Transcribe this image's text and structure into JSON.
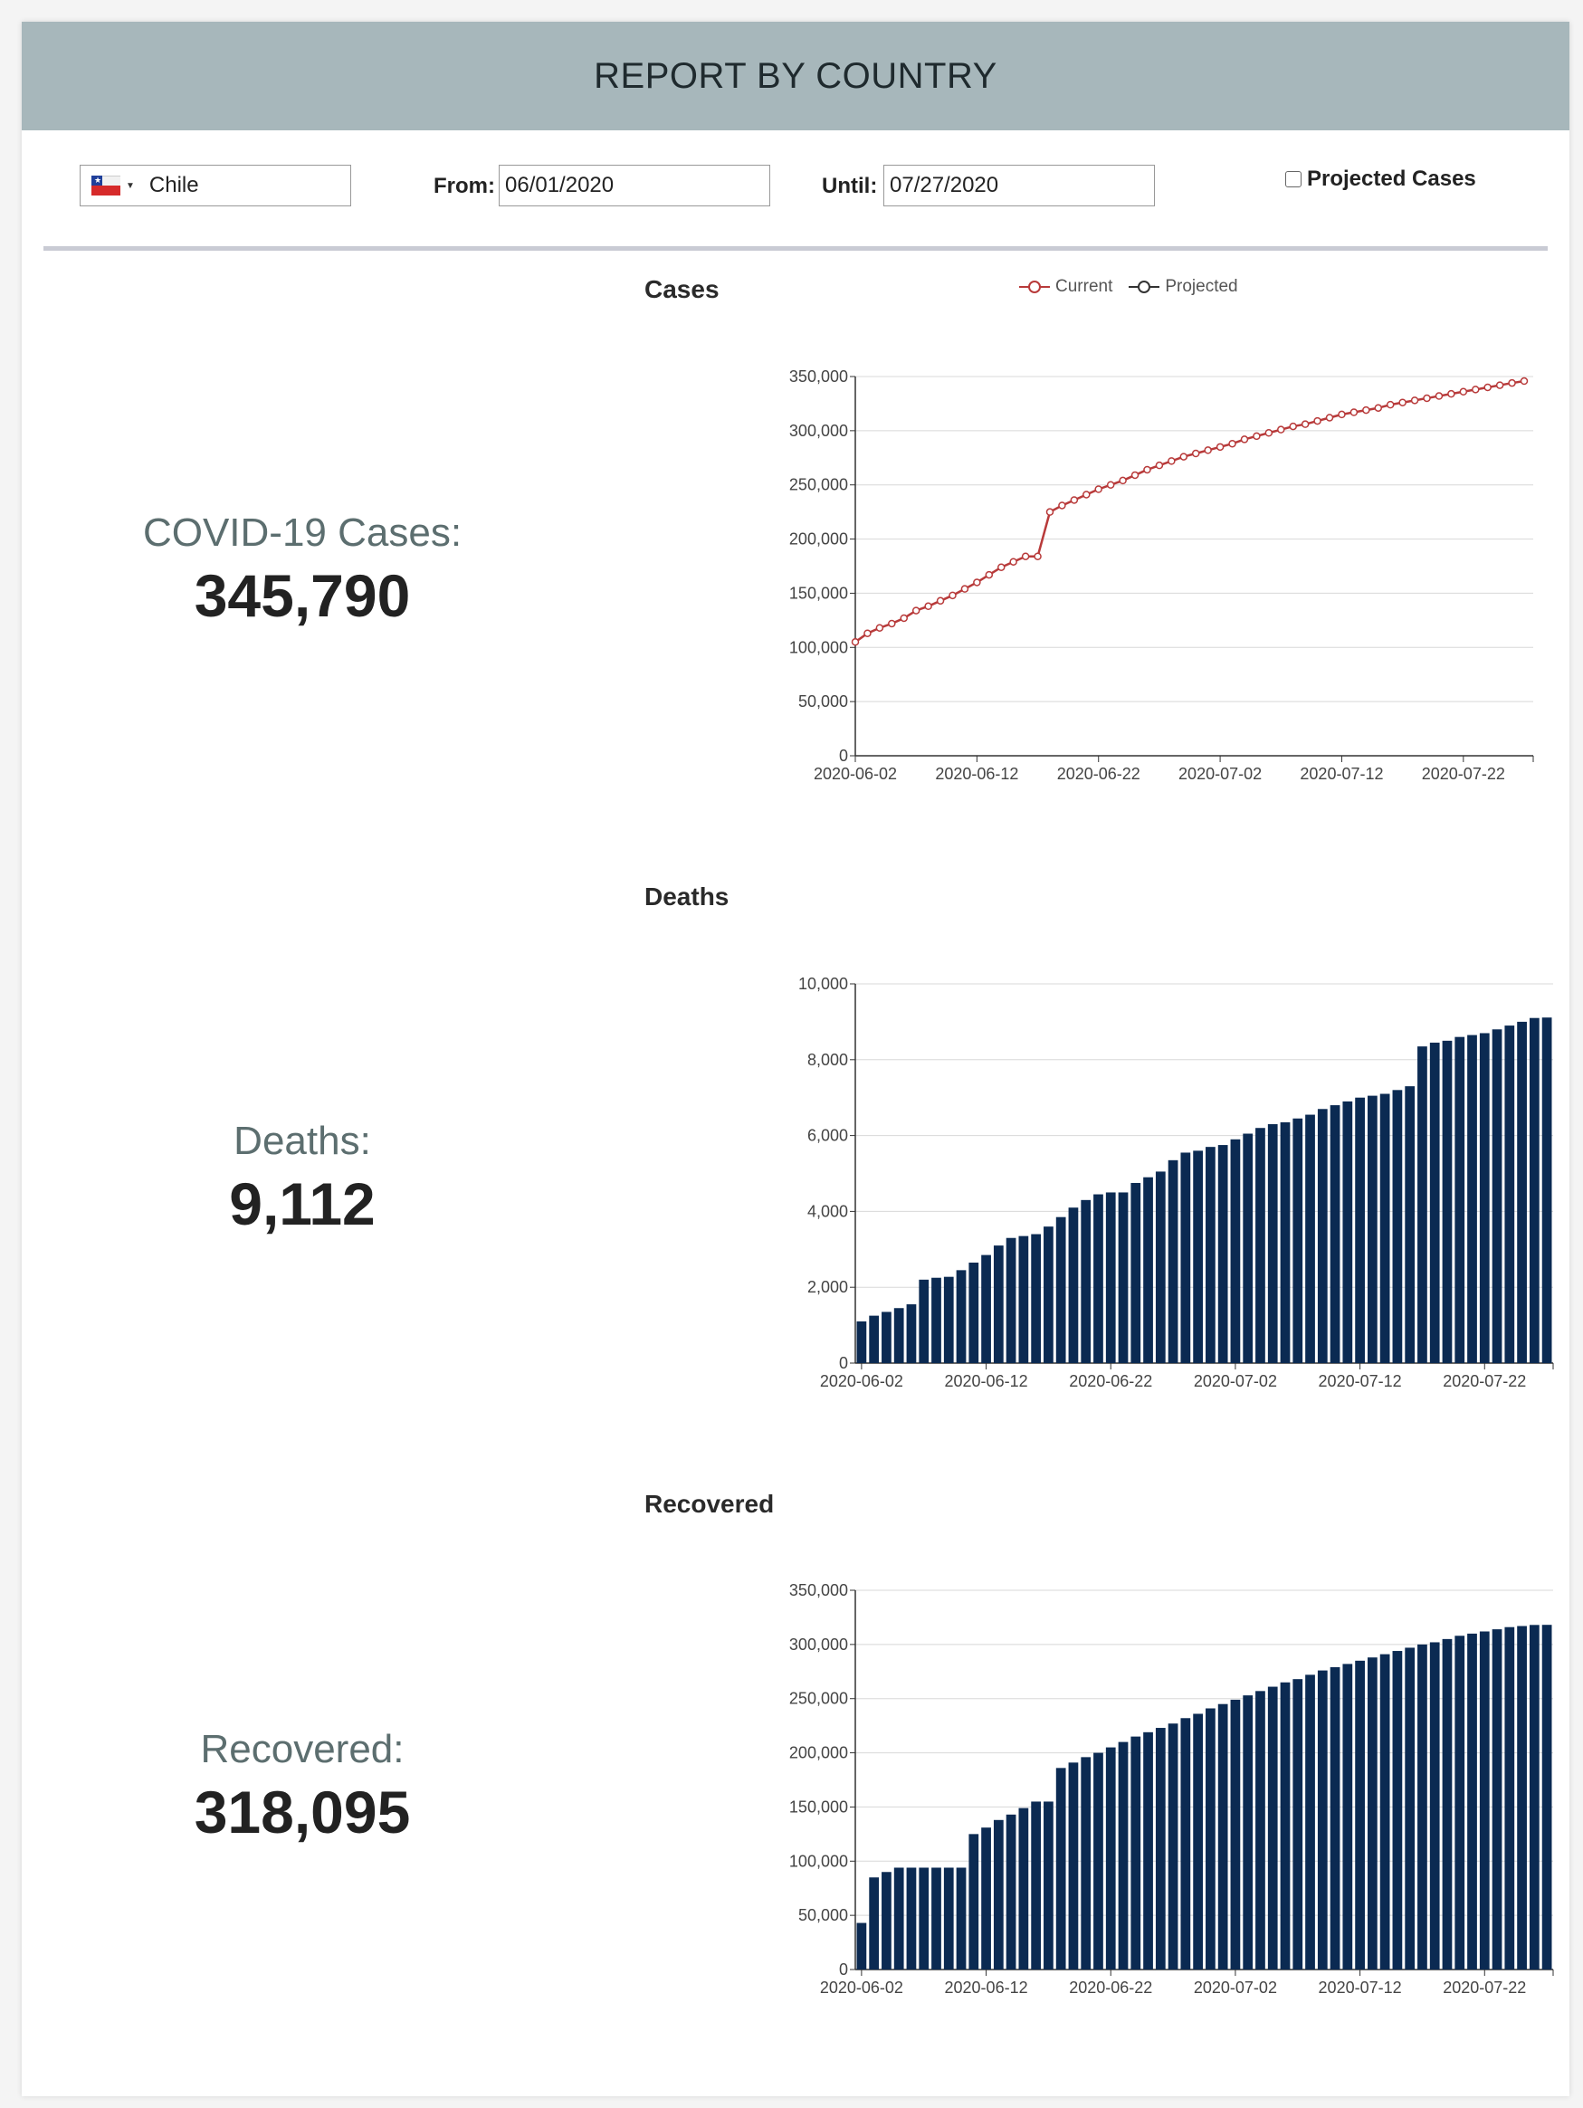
{
  "header": {
    "title": "REPORT BY COUNTRY"
  },
  "controls": {
    "country": "Chile",
    "from_label": "From:",
    "from_value": "06/01/2020",
    "until_label": "Until:",
    "until_value": "07/27/2020",
    "projected_label": "Projected Cases",
    "projected_checked": false
  },
  "stats": {
    "cases_label": "COVID-19 Cases:",
    "cases_value": "345,790",
    "deaths_label": "Deaths:",
    "deaths_value": "9,112",
    "recovered_label": "Recovered:",
    "recovered_value": "318,095"
  },
  "colors": {
    "current": "#b83a3a",
    "projected": "#333333",
    "bar": "#0b2a52",
    "header": "#a7b7bb"
  },
  "chart_data": [
    {
      "type": "line",
      "title": "Cases",
      "legend": [
        "Current",
        "Projected"
      ],
      "legend_position": "top",
      "x_start": "2020-06-02",
      "x_end": "2020-07-27",
      "x_ticks": [
        "2020-06-02",
        "2020-06-12",
        "2020-06-22",
        "2020-07-02",
        "2020-07-12",
        "2020-07-22"
      ],
      "ylim": [
        0,
        350000
      ],
      "y_ticks": [
        "0",
        "50,000",
        "100,000",
        "150,000",
        "200,000",
        "250,000",
        "300,000",
        "350,000"
      ],
      "grid": true,
      "series": [
        {
          "name": "Current",
          "values": [
            105000,
            113000,
            118000,
            122000,
            127000,
            134000,
            138000,
            143000,
            148000,
            154000,
            160000,
            167000,
            174000,
            179000,
            184000,
            184000,
            225000,
            231000,
            236000,
            241000,
            246000,
            250000,
            254000,
            259000,
            264000,
            268000,
            272000,
            276000,
            279000,
            282000,
            285000,
            288000,
            292000,
            295000,
            298000,
            301000,
            304000,
            306000,
            309000,
            312000,
            315000,
            317000,
            319000,
            321000,
            324000,
            326000,
            328000,
            330000,
            332000,
            334000,
            336000,
            338000,
            340000,
            342000,
            344000,
            345790
          ]
        }
      ]
    },
    {
      "type": "bar",
      "title": "Deaths",
      "x_start": "2020-06-02",
      "x_end": "2020-07-27",
      "x_ticks": [
        "2020-06-02",
        "2020-06-12",
        "2020-06-22",
        "2020-07-02",
        "2020-07-12",
        "2020-07-22"
      ],
      "ylim": [
        0,
        10000
      ],
      "y_ticks": [
        "0",
        "2,000",
        "4,000",
        "6,000",
        "8,000",
        "10,000"
      ],
      "grid": true,
      "values": [
        1100,
        1250,
        1350,
        1450,
        1550,
        2200,
        2250,
        2275,
        2450,
        2650,
        2850,
        3100,
        3300,
        3350,
        3400,
        3600,
        3850,
        4100,
        4300,
        4450,
        4500,
        4500,
        4750,
        4900,
        5050,
        5350,
        5550,
        5600,
        5700,
        5750,
        5900,
        6050,
        6200,
        6300,
        6350,
        6450,
        6550,
        6700,
        6800,
        6900,
        7000,
        7050,
        7100,
        7200,
        7300,
        8350,
        8450,
        8500,
        8600,
        8650,
        8700,
        8800,
        8900,
        9000,
        9100,
        9112
      ]
    },
    {
      "type": "bar",
      "title": "Recovered",
      "x_start": "2020-06-02",
      "x_end": "2020-07-27",
      "x_ticks": [
        "2020-06-02",
        "2020-06-12",
        "2020-06-22",
        "2020-07-02",
        "2020-07-12",
        "2020-07-22"
      ],
      "ylim": [
        0,
        350000
      ],
      "y_ticks": [
        "0",
        "50,000",
        "100,000",
        "150,000",
        "200,000",
        "250,000",
        "300,000",
        "350,000"
      ],
      "grid": true,
      "values": [
        43000,
        85000,
        90000,
        94000,
        94000,
        94000,
        94000,
        94000,
        94000,
        125000,
        131000,
        138000,
        143000,
        149000,
        155000,
        155000,
        186000,
        191000,
        196000,
        200000,
        205000,
        210000,
        215000,
        219000,
        223000,
        227000,
        232000,
        236000,
        241000,
        245000,
        249000,
        253000,
        257000,
        261000,
        265000,
        268000,
        272000,
        276000,
        279000,
        282000,
        285000,
        288000,
        291000,
        294000,
        297000,
        300000,
        302000,
        305000,
        308000,
        310000,
        312000,
        314000,
        316000,
        317000,
        318000,
        318095
      ]
    }
  ]
}
